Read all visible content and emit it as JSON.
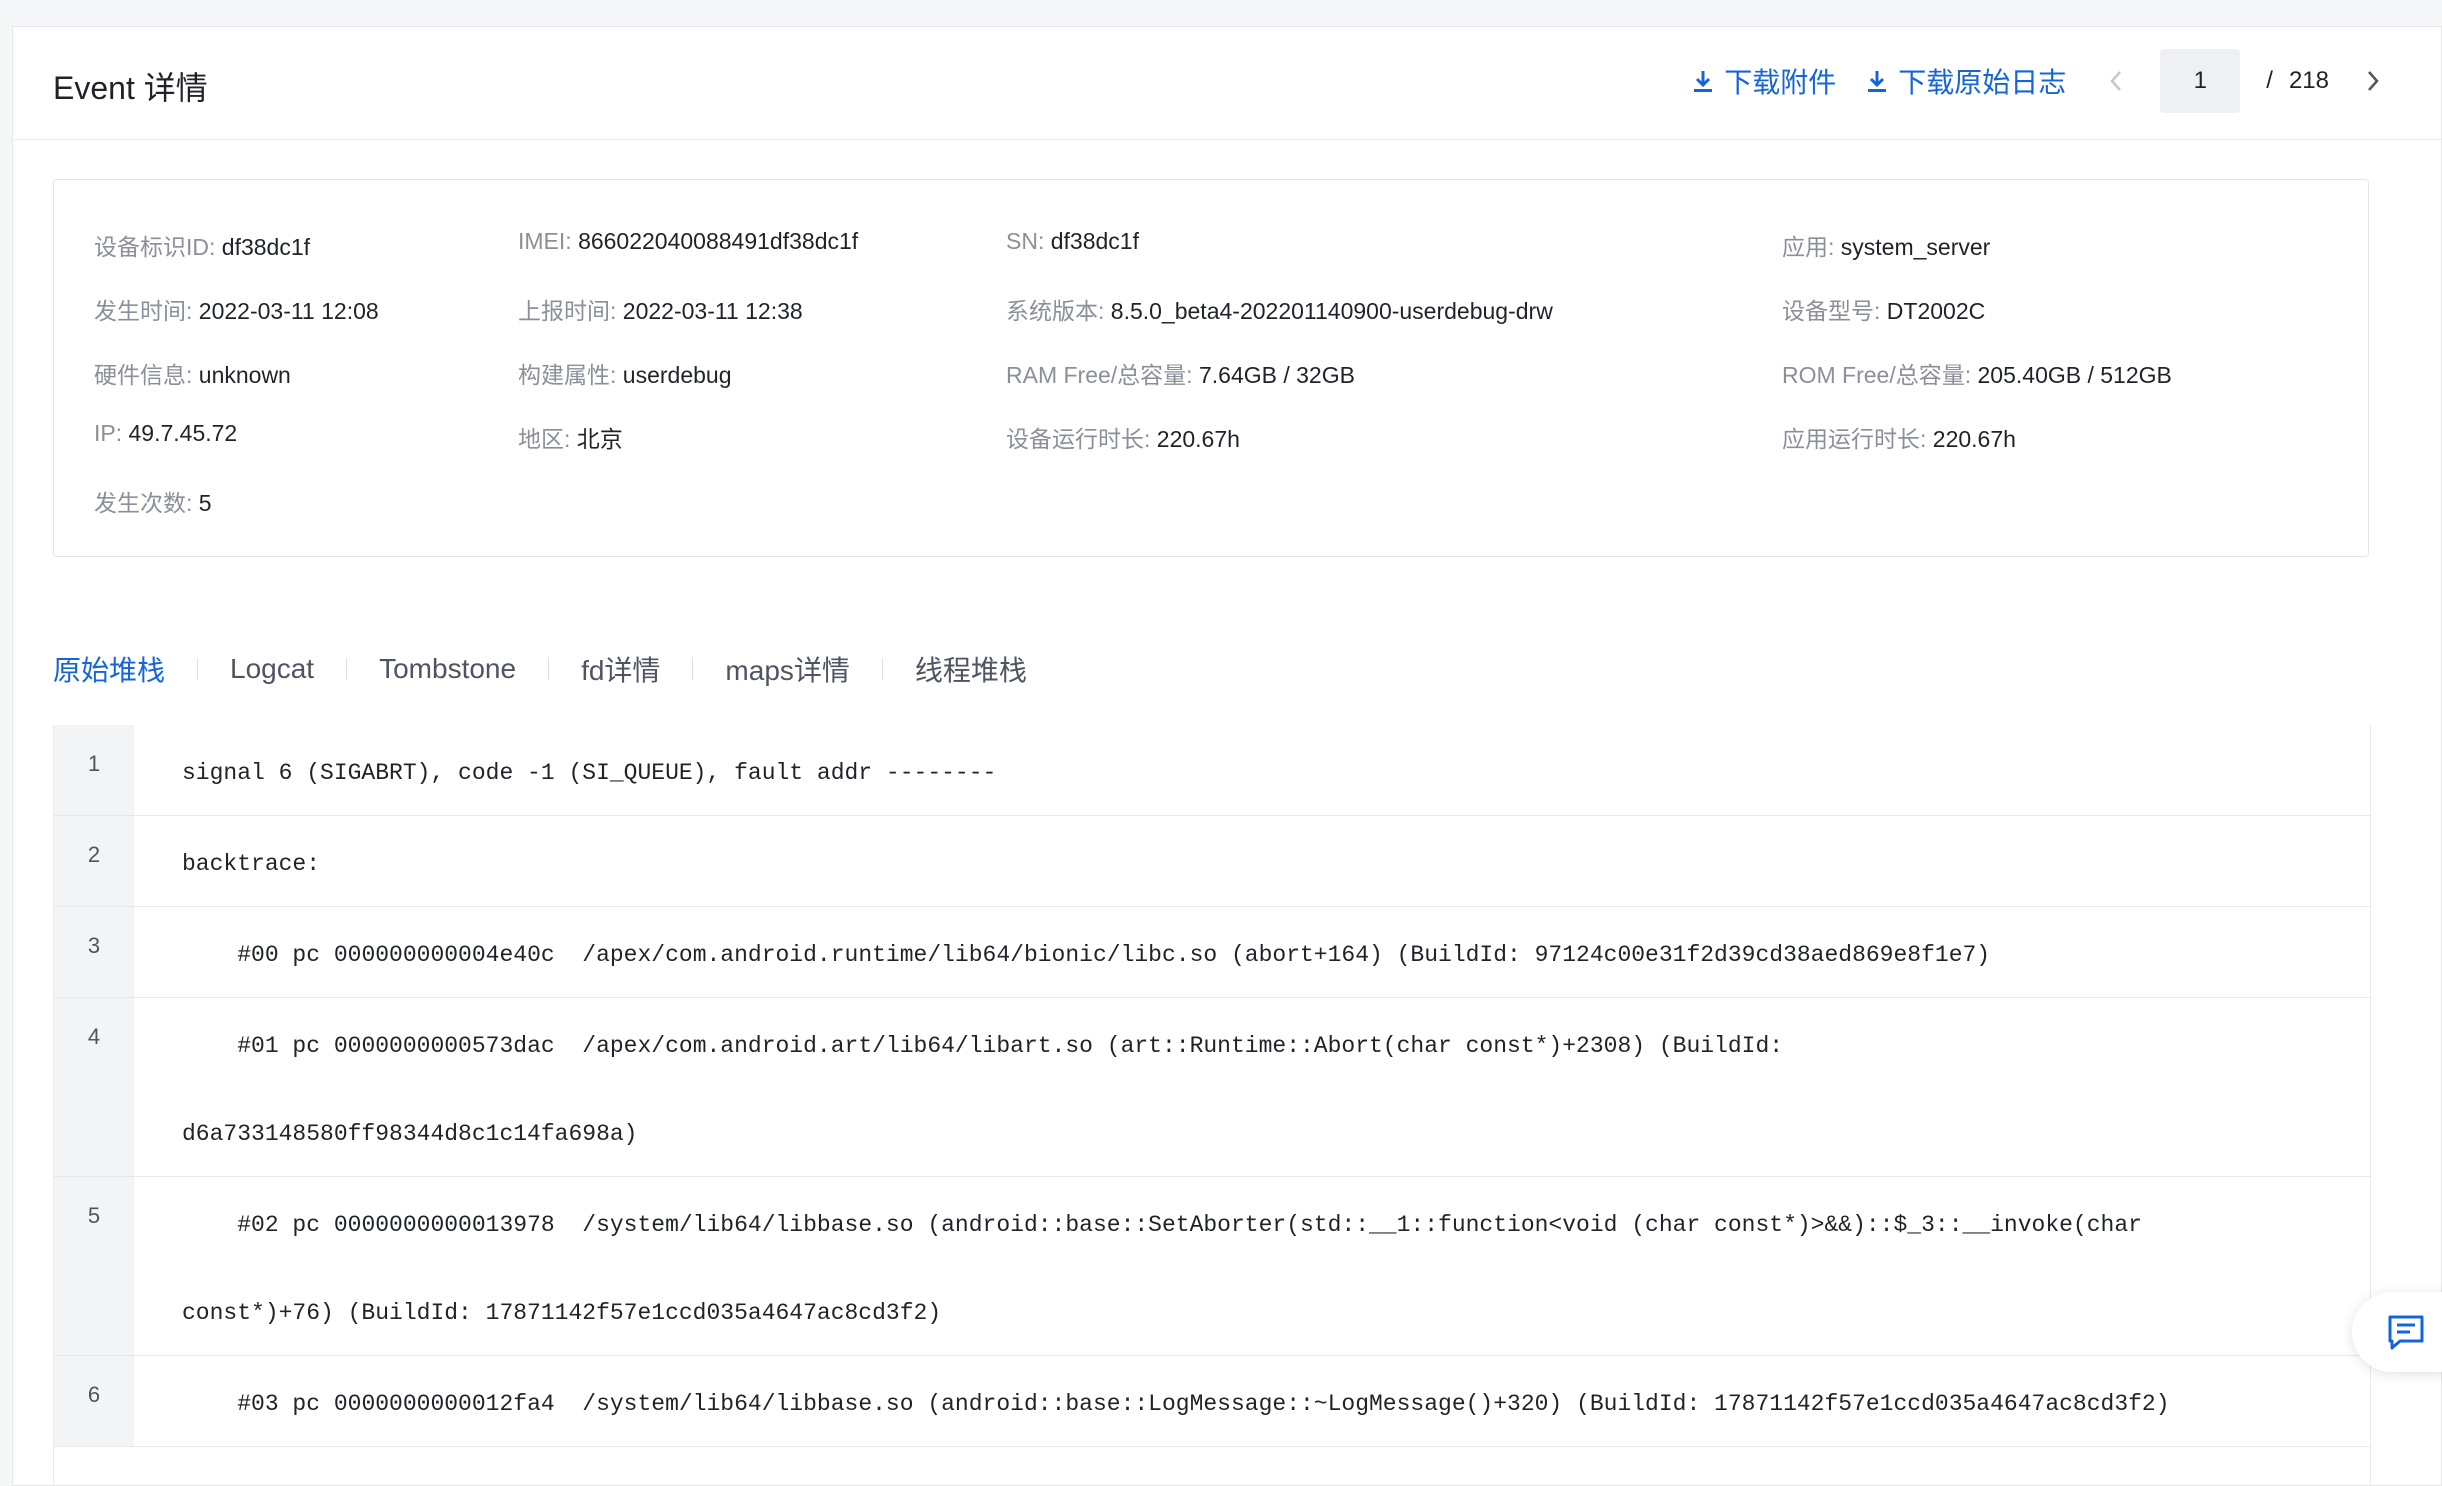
{
  "header": {
    "title": "Event 详情",
    "download_attachment": "下载附件",
    "download_log": "下载原始日志",
    "pager": {
      "current": "1",
      "separator": "/",
      "total": "218"
    }
  },
  "info": [
    {
      "label": "设备标识ID:",
      "value": "df38dc1f"
    },
    {
      "label": "IMEI:",
      "value": "866022040088491df38dc1f"
    },
    {
      "label": "SN:",
      "value": "df38dc1f"
    },
    {
      "label": "应用:",
      "value": "system_server"
    },
    {
      "label": "发生时间:",
      "value": "2022-03-11 12:08"
    },
    {
      "label": "上报时间:",
      "value": "2022-03-11 12:38"
    },
    {
      "label": "系统版本:",
      "value": "8.5.0_beta4-202201140900-userdebug-drw"
    },
    {
      "label": "设备型号:",
      "value": "DT2002C"
    },
    {
      "label": "硬件信息:",
      "value": "unknown"
    },
    {
      "label": "构建属性:",
      "value": "userdebug"
    },
    {
      "label": "RAM Free/总容量:",
      "value": "7.64GB / 32GB"
    },
    {
      "label": "ROM Free/总容量:",
      "value": "205.40GB / 512GB"
    },
    {
      "label": "IP:",
      "value": "49.7.45.72"
    },
    {
      "label": "地区:",
      "value": "北京"
    },
    {
      "label": "设备运行时长:",
      "value": "220.67h"
    },
    {
      "label": "应用运行时长:",
      "value": "220.67h"
    },
    {
      "label": "发生次数:",
      "value": "5"
    }
  ],
  "tabs": [
    "原始堆栈",
    "Logcat",
    "Tombstone",
    "fd详情",
    "maps详情",
    "线程堆栈"
  ],
  "active_tab": "原始堆栈",
  "code_lines": [
    {
      "n": "1",
      "text": "signal 6 (SIGABRT), code -1 (SI_QUEUE), fault addr --------"
    },
    {
      "n": "2",
      "text": "backtrace:"
    },
    {
      "n": "3",
      "text": "    #00 pc 000000000004e40c  /apex/com.android.runtime/lib64/bionic/libc.so (abort+164) (BuildId: 97124c00e31f2d39cd38aed869e8f1e7)"
    },
    {
      "n": "4",
      "text": "    #01 pc 0000000000573dac  /apex/com.android.art/lib64/libart.so (art::Runtime::Abort(char const*)+2308) (BuildId:\nd6a733148580ff98344d8c1c14fa698a)"
    },
    {
      "n": "5",
      "text": "    #02 pc 0000000000013978  /system/lib64/libbase.so (android::base::SetAborter(std::__1::function<void (char const*)>&&)::$_3::__invoke(char\nconst*)+76) (BuildId: 17871142f57e1ccd035a4647ac8cd3f2)"
    },
    {
      "n": "6",
      "text": "    #03 pc 0000000000012fa4  /system/lib64/libbase.so (android::base::LogMessage::~LogMessage()+320) (BuildId: 17871142f57e1ccd035a4647ac8cd3f2)"
    }
  ],
  "colors": {
    "accent": "#1565d8",
    "label": "#8a8f99",
    "text": "#1f2329"
  }
}
